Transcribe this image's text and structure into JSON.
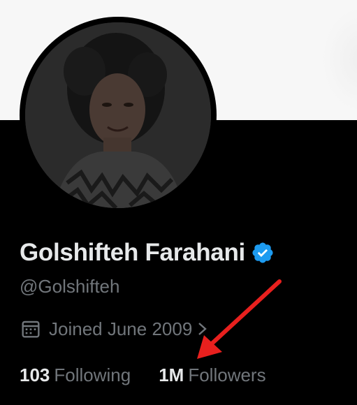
{
  "profile": {
    "display_name": "Golshifteh Farahani",
    "handle": "@Golshifteh",
    "joined": "Joined June 2009",
    "following_count": "103",
    "following_label": "Following",
    "followers_count": "1M",
    "followers_label": "Followers",
    "verified_icon": "verified-badge-icon",
    "calendar_icon": "calendar-icon",
    "chevron_icon": "chevron-right-icon"
  },
  "colors": {
    "background": "#000000",
    "banner": "#f7f7f7",
    "primary_text": "#e7e9ea",
    "secondary_text": "#71767b",
    "verified_blue": "#1d9bf0",
    "annotation_red": "#e8201e"
  }
}
